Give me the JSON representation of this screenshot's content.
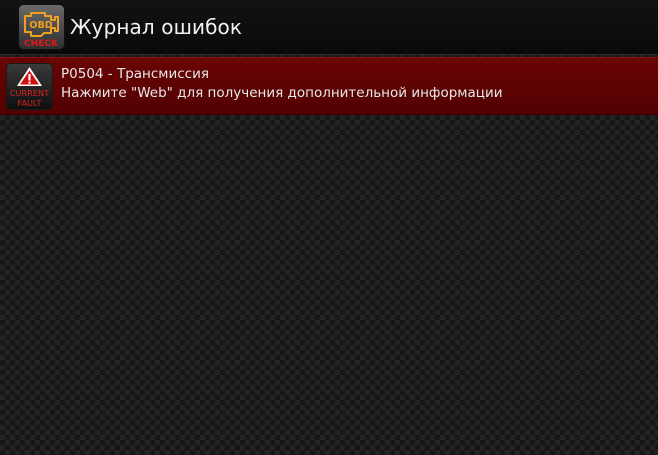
{
  "header": {
    "title": "Журнал ошибок",
    "app_icon": {
      "name": "obd-check-engine-icon",
      "obd_text": "OBD",
      "check_text": "CHECK",
      "accent_color": "#f0a020",
      "check_color": "#e01818"
    }
  },
  "faults": [
    {
      "icon": "current-fault-warning-icon",
      "icon_line1": "CURRENT",
      "icon_line2": "FAULT",
      "code_line": "P0504 - Трансмиссия",
      "hint": "Нажмите \"Web\" для получения дополнительной информации",
      "row_color": "#5e0303"
    }
  ]
}
